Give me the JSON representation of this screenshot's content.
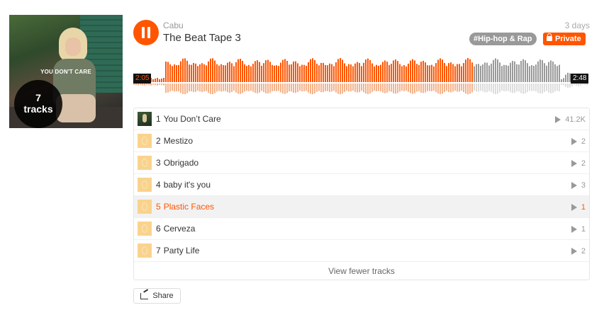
{
  "playlist": {
    "artist": "Cabu",
    "title": "The Beat Tape 3",
    "age": "3 days",
    "genre": "#Hip-hop & Rap",
    "privacy": "Private",
    "artwork_text": "YOU DON'T CARE",
    "track_count": "7",
    "track_count_label": "tracks"
  },
  "player": {
    "current_time": "2:05",
    "total_time": "2:48",
    "progress": 0.746,
    "colors": {
      "played": "#ff5500",
      "played_reflection": "#f5b28a",
      "unplayed": "#999999",
      "unplayed_reflection": "#dddddd"
    }
  },
  "tracks": [
    {
      "num": "1",
      "name": "You Don’t Care",
      "plays": "41.2K"
    },
    {
      "num": "2",
      "name": "Mestizo",
      "plays": "2"
    },
    {
      "num": "3",
      "name": "Obrigado",
      "plays": "2"
    },
    {
      "num": "4",
      "name": "baby it's you",
      "plays": "3"
    },
    {
      "num": "5",
      "name": "Plastic Faces",
      "plays": "1"
    },
    {
      "num": "6",
      "name": "Cerveza",
      "plays": "1"
    },
    {
      "num": "7",
      "name": "Party Life",
      "plays": "2"
    }
  ],
  "view_fewer_label": "View fewer tracks",
  "share_label": "Share",
  "accent": "#ff5500"
}
